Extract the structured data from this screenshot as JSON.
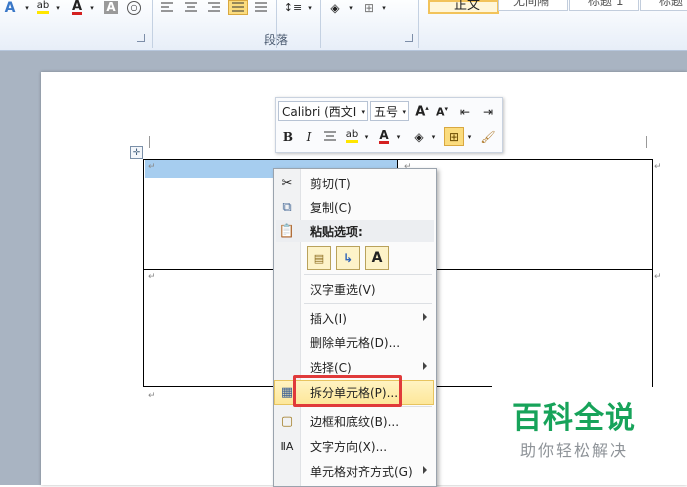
{
  "ribbon": {
    "paragraph_group_label": "段落",
    "style_items": [
      "正文",
      "无间隔",
      "标题 1",
      "标题"
    ]
  },
  "mini_toolbar": {
    "font_name": "Calibri (西文I",
    "font_size": "五号",
    "bold_label": "B",
    "italic_label": "I",
    "font_color_label": "A"
  },
  "context_menu": {
    "items": [
      {
        "label": "剪切(T)",
        "icon": "scissors-icon"
      },
      {
        "label": "复制(C)",
        "icon": "copy-icon"
      },
      {
        "label": "粘贴选项:",
        "icon": "clipboard-icon"
      },
      {
        "label": "汉字重选(V)"
      },
      {
        "label": "插入(I)",
        "submenu": true
      },
      {
        "label": "删除单元格(D)..."
      },
      {
        "label": "选择(C)",
        "submenu": true
      },
      {
        "label": "拆分单元格(P)...",
        "icon": "split-cells-icon",
        "highlighted": true
      },
      {
        "label": "边框和底纹(B)...",
        "icon": "borders-icon"
      },
      {
        "label": "文字方向(X)...",
        "icon": "text-direction-icon"
      },
      {
        "label": "单元格对齐方式(G)",
        "submenu": true
      }
    ],
    "paste_options": [
      "keep-formatting",
      "merge-formatting",
      "text-only"
    ],
    "paste_text_only_label": "A"
  },
  "watermark": {
    "title": "百科全说",
    "subtitle": "助你轻松解决"
  },
  "colors": {
    "highlight": "#fde79a",
    "annotation_red": "#e03a3a",
    "watermark_green": "#17a35a",
    "cell_selection": "#a6cdef"
  }
}
